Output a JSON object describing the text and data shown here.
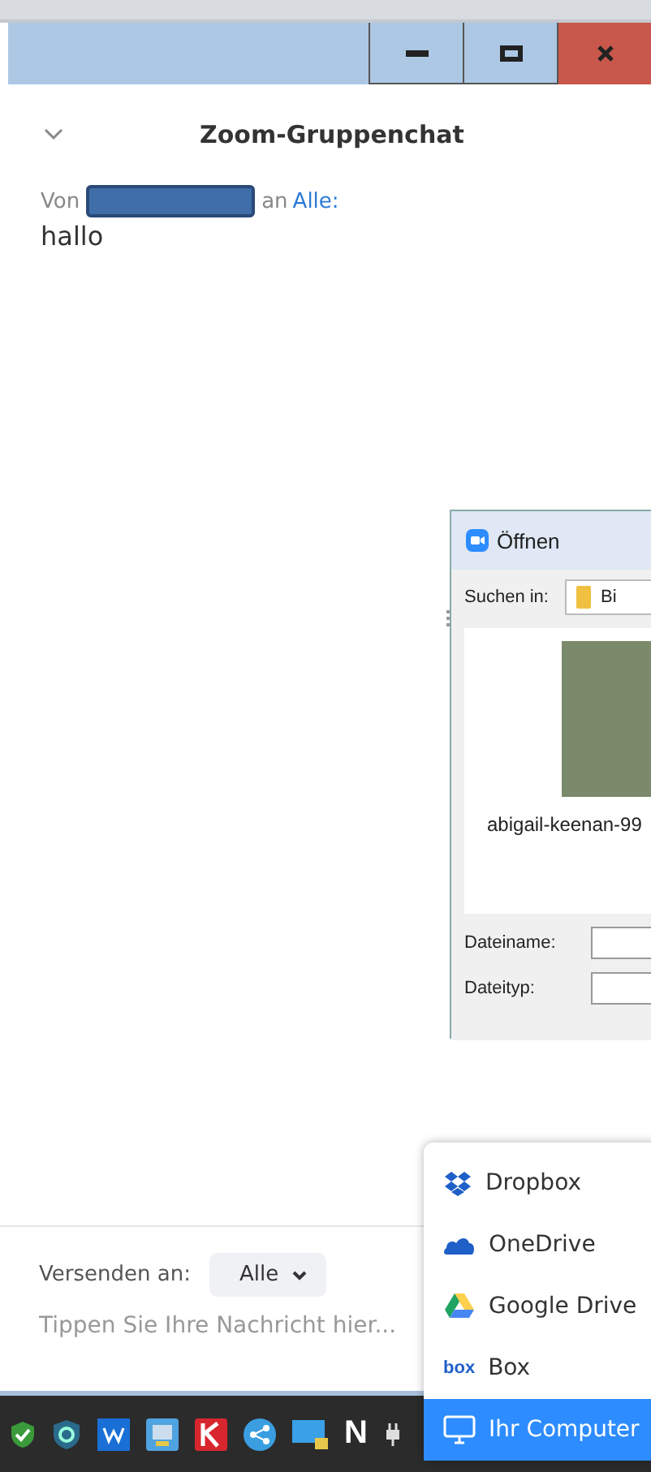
{
  "window": {
    "controls": [
      {
        "kind": "minimize"
      },
      {
        "kind": "maximize"
      },
      {
        "kind": "close"
      }
    ]
  },
  "chat": {
    "title": "Zoom-Gruppenchat",
    "message": {
      "from_label": "Von",
      "to_label": "an",
      "recipient": "Alle:",
      "text": "hallo"
    }
  },
  "open_dialog": {
    "title": "Öffnen",
    "look_in_label": "Suchen in:",
    "look_in_value": "Bi",
    "file_name": "abigail-keenan-99",
    "file_name_label": "Dateiname:",
    "file_type_label": "Dateityp:"
  },
  "composer": {
    "send_to_label": "Versenden an:",
    "send_to_value": "Alle",
    "placeholder": "Tippen Sie Ihre Nachricht hier..."
  },
  "share_menu": [
    {
      "kind": "dropbox",
      "label": "Dropbox",
      "selected": false
    },
    {
      "kind": "onedrive",
      "label": "OneDrive",
      "selected": false
    },
    {
      "kind": "gdrive",
      "label": "Google Drive",
      "selected": false
    },
    {
      "kind": "box",
      "logo": "box",
      "label": "Box",
      "selected": false
    },
    {
      "kind": "computer",
      "label": "Ihr Computer",
      "selected": true
    }
  ],
  "taskbar": [
    {
      "kind": "shield-check"
    },
    {
      "kind": "shield"
    },
    {
      "kind": "w"
    },
    {
      "kind": "screen"
    },
    {
      "kind": "k"
    },
    {
      "kind": "share"
    },
    {
      "kind": "monitor"
    },
    {
      "kind": "letter",
      "text": "N"
    },
    {
      "kind": "plug"
    }
  ]
}
